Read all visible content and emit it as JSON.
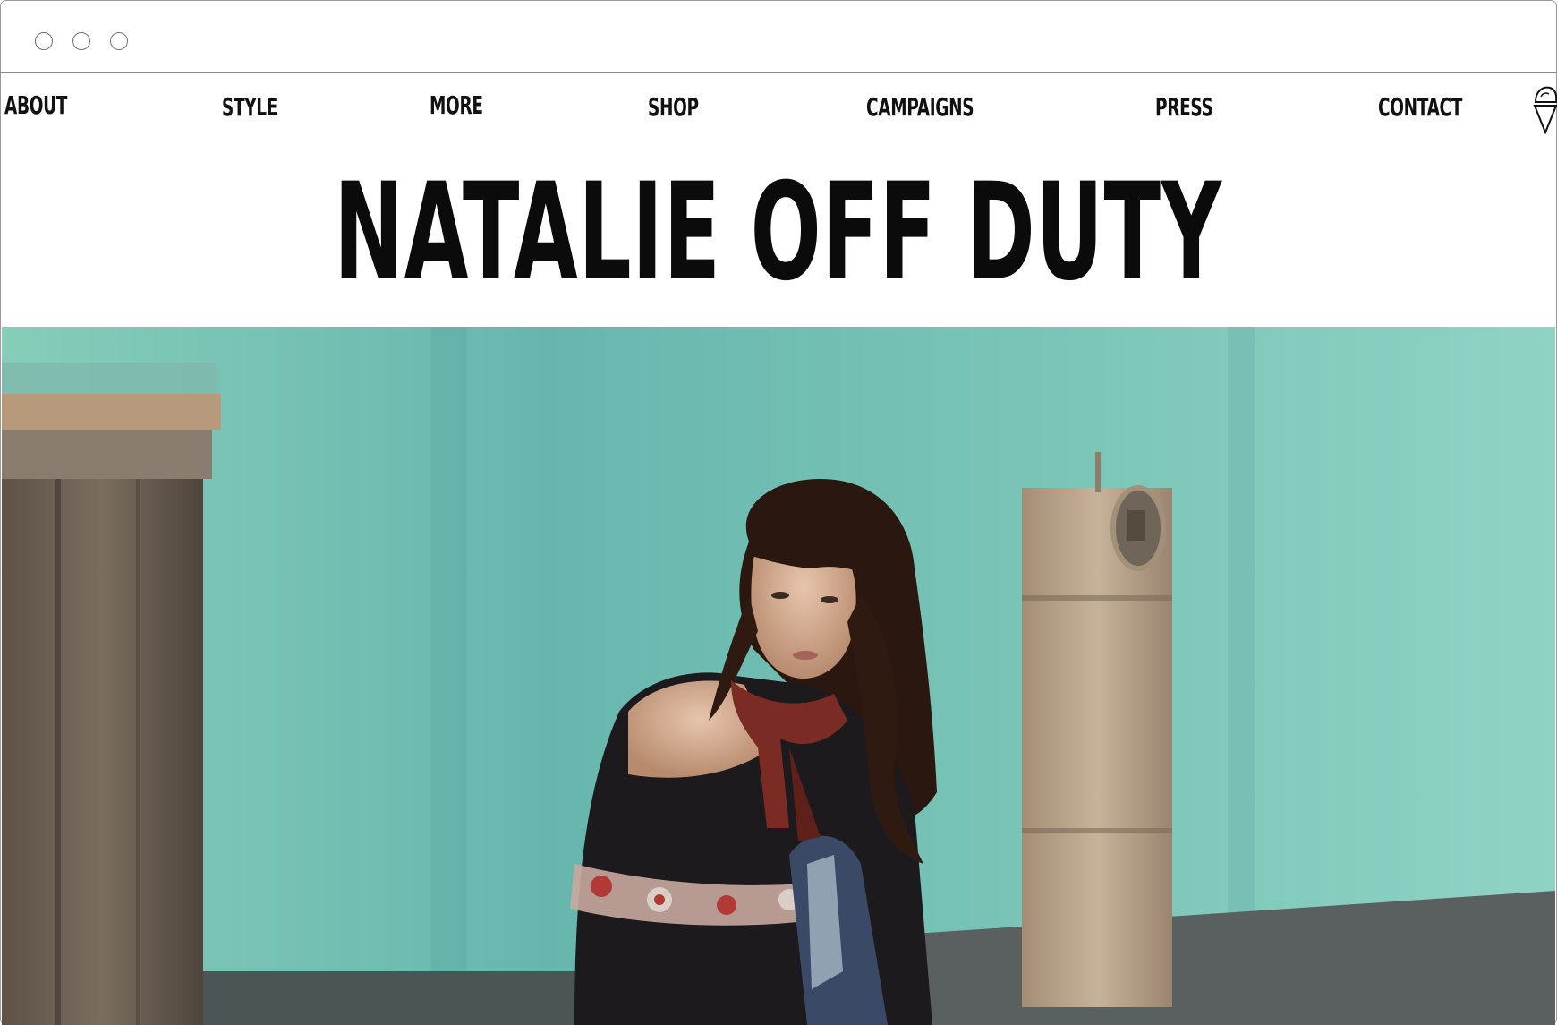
{
  "window": {
    "controls": [
      "close",
      "minimize",
      "maximize"
    ]
  },
  "nav": {
    "items": [
      {
        "label": "ABOUT"
      },
      {
        "label": "STYLE"
      },
      {
        "label": "MORE"
      },
      {
        "label": "SHOP"
      },
      {
        "label": "CAMPAIGNS"
      },
      {
        "label": "PRESS"
      },
      {
        "label": "CONTACT"
      }
    ],
    "icon": "ice-cream-cone-icon"
  },
  "header": {
    "title": "NATALIE OFF DUTY"
  },
  "hero": {
    "image": "photo of a woman with bangs leaning against a turquoise wall beside an electric meter box",
    "colors": {
      "wall": "#7cc6b6",
      "wood": "#6b5e52",
      "meter": "#b59f86",
      "hair": "#2a1710"
    }
  }
}
